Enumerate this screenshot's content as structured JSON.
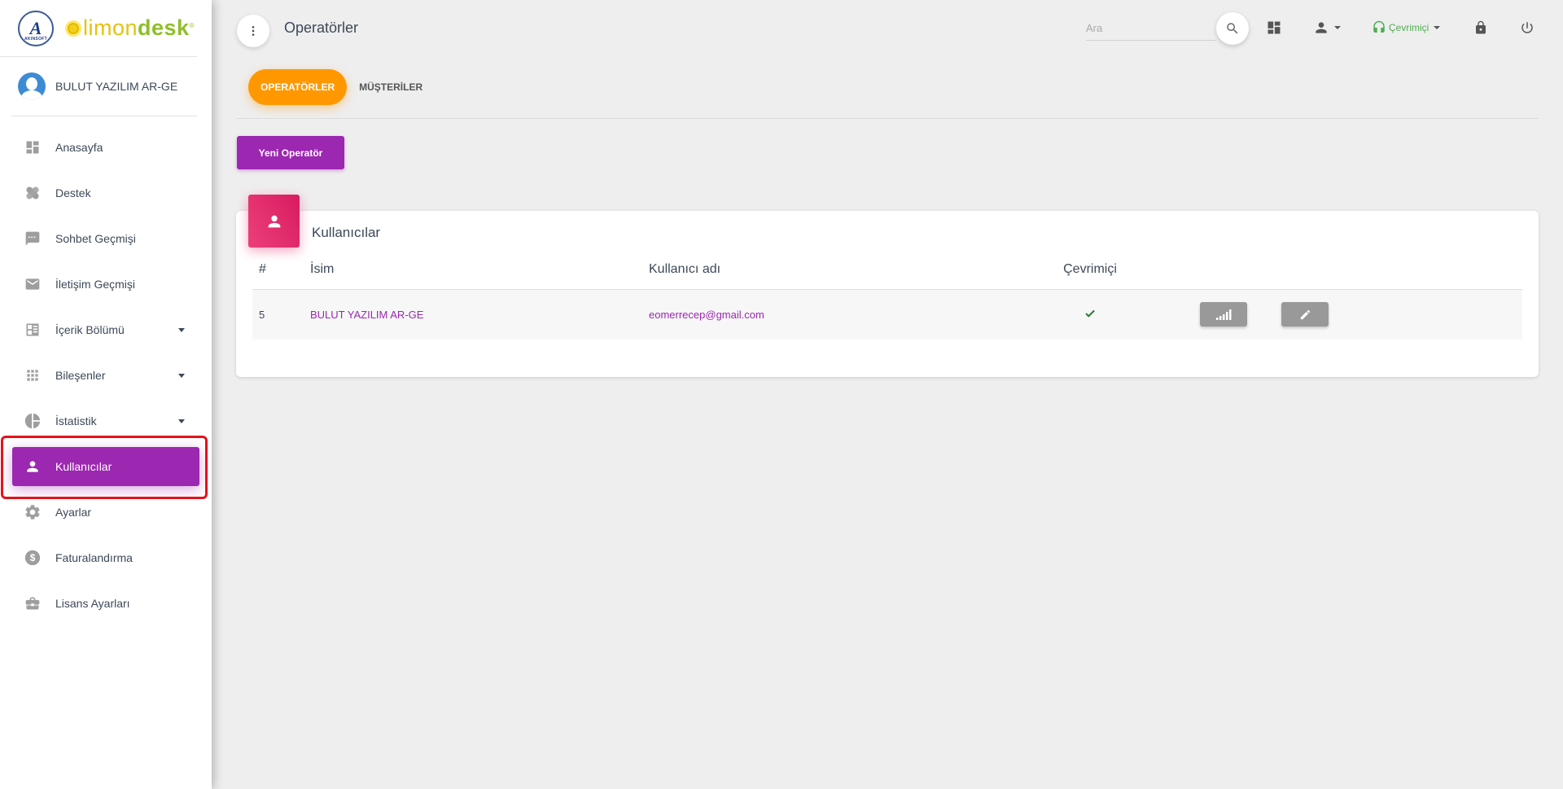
{
  "brand": {
    "logo_text": "AKINSOFT",
    "name_part1": "limon",
    "name_part2": "desk",
    "reg_mark": "®"
  },
  "user": {
    "name": "BULUT YAZILIM AR-GE"
  },
  "sidebar": {
    "items": [
      {
        "label": "Anasayfa",
        "icon": "dashboard-icon",
        "has_caret": false,
        "active": false
      },
      {
        "label": "Destek",
        "icon": "bandage-icon",
        "has_caret": false,
        "active": false
      },
      {
        "label": "Sohbet Geçmişi",
        "icon": "chat-icon",
        "has_caret": false,
        "active": false
      },
      {
        "label": "İletişim Geçmişi",
        "icon": "mail-icon",
        "has_caret": false,
        "active": false
      },
      {
        "label": "İçerik Bölümü",
        "icon": "content-list-icon",
        "has_caret": true,
        "active": false
      },
      {
        "label": "Bileşenler",
        "icon": "apps-grid-icon",
        "has_caret": true,
        "active": false
      },
      {
        "label": "İstatistik",
        "icon": "pie-chart-icon",
        "has_caret": true,
        "active": false
      },
      {
        "label": "Kullanıcılar",
        "icon": "person-icon",
        "has_caret": false,
        "active": true
      },
      {
        "label": "Ayarlar",
        "icon": "gear-icon",
        "has_caret": false,
        "active": false
      },
      {
        "label": "Faturalandırma",
        "icon": "dollar-icon",
        "has_caret": false,
        "active": false
      },
      {
        "label": "Lisans Ayarları",
        "icon": "briefcase-icon",
        "has_caret": false,
        "active": false
      }
    ]
  },
  "topbar": {
    "title": "Operatörler",
    "search_placeholder": "Ara",
    "status_label": "Çevrimiçi",
    "colors": {
      "status": "#4caf50"
    }
  },
  "tabs": [
    {
      "label": "OPERATÖRLER",
      "active": true
    },
    {
      "label": "MÜŞTERİLER",
      "active": false
    }
  ],
  "new_button": "Yeni Operatör",
  "card": {
    "title": "Kullanıcılar",
    "columns": [
      "#",
      "İsim",
      "Kullanıcı adı",
      "Çevrimiçi",
      "",
      ""
    ],
    "rows": [
      {
        "id": "5",
        "name": "BULUT YAZILIM AR-GE",
        "username": "eomerrecep@gmail.com",
        "online": true
      }
    ]
  },
  "colors": {
    "primary": "#9c27b0",
    "tab_active": "#ff9800",
    "card_icon": "#e91e63",
    "highlight": "#e3131b"
  }
}
